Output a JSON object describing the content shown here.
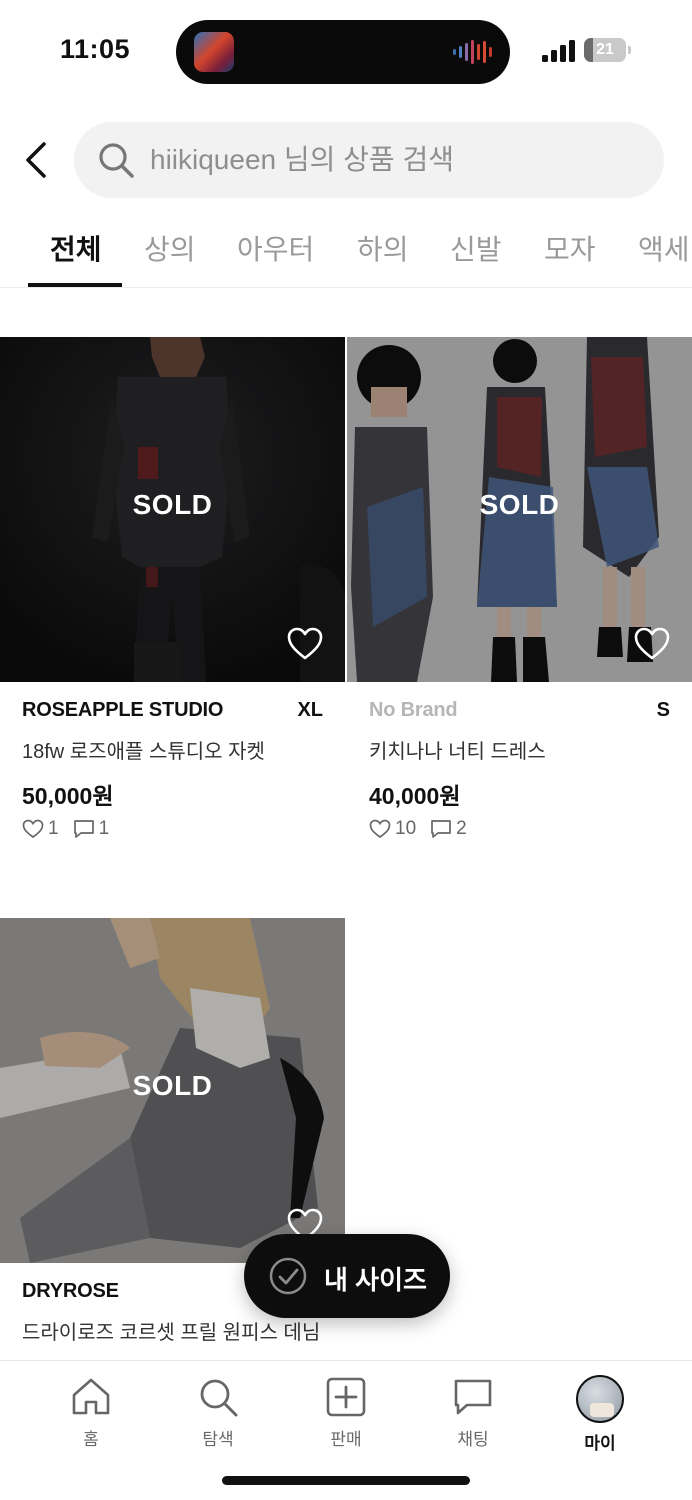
{
  "status_bar": {
    "time": "11:05",
    "battery": "21",
    "battery_level": 0.21
  },
  "header": {
    "search_placeholder": "hiikiqueen 님의 상품 검색"
  },
  "tabs": [
    {
      "label": "전체",
      "active": true
    },
    {
      "label": "상의"
    },
    {
      "label": "아우터"
    },
    {
      "label": "하의"
    },
    {
      "label": "신발"
    },
    {
      "label": "모자"
    },
    {
      "label": "액세"
    }
  ],
  "products": [
    {
      "brand": "ROSEAPPLE STUDIO",
      "size": "XL",
      "name": "18fw 로즈애플 스튜디오 자켓",
      "price": "50,000원",
      "likes": "1",
      "comments": "1",
      "sold": "SOLD"
    },
    {
      "brand": "No Brand",
      "size": "S",
      "name": "키치나나 너티 드레스",
      "price": "40,000원",
      "likes": "10",
      "comments": "2",
      "sold": "SOLD"
    },
    {
      "brand": "DRYROSE",
      "size": "",
      "name": "드라이로즈 코르셋 프릴 원피스 데님",
      "price": "",
      "likes": "",
      "comments": "",
      "sold": "SOLD"
    }
  ],
  "size_chip": {
    "label": "내 사이즈"
  },
  "bottom_nav": [
    {
      "label": "홈",
      "icon": "home-icon"
    },
    {
      "label": "탐색",
      "icon": "search-icon"
    },
    {
      "label": "판매",
      "icon": "plus-square-icon"
    },
    {
      "label": "채팅",
      "icon": "chat-icon"
    },
    {
      "label": "마이",
      "icon": "avatar",
      "active": true
    }
  ],
  "colors": {
    "accent": "#111111",
    "muted_text": "#9a9a9a",
    "chip_bg": "#0d0d0d"
  }
}
